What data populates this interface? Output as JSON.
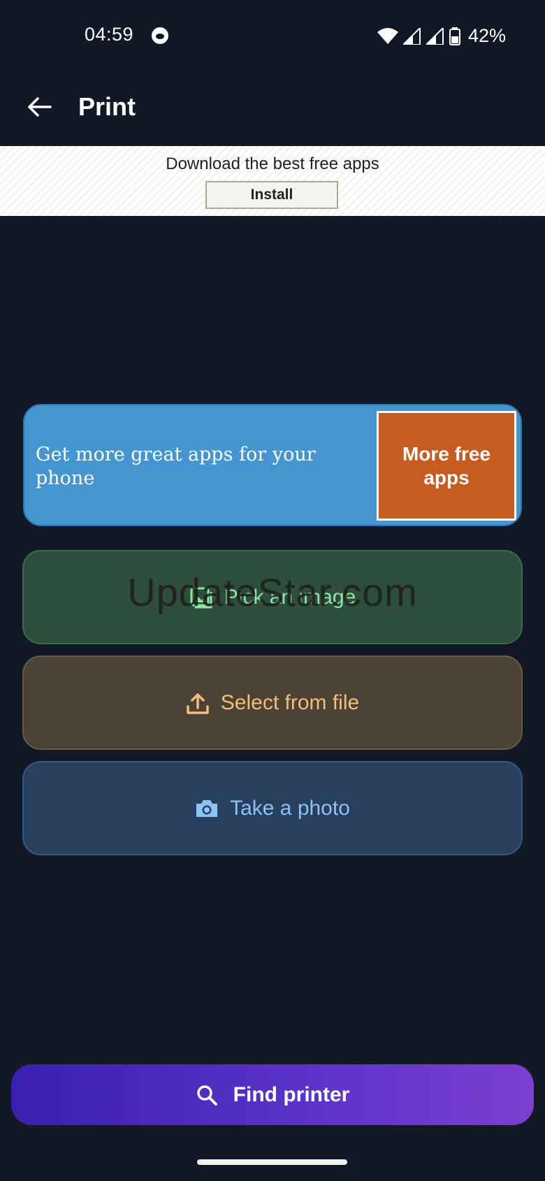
{
  "status_bar": {
    "time": "04:59",
    "battery_percent": "42%",
    "icons": [
      "notification-cat-icon",
      "wifi-icon",
      "signal-icon",
      "signal-icon",
      "battery-icon"
    ]
  },
  "app_bar": {
    "title": "Print",
    "back_icon": "arrow-left-icon"
  },
  "ad_banner": {
    "text": "Download the best free apps",
    "install_label": "Install"
  },
  "promo": {
    "text": "Get more great apps for your phone",
    "button_label": "More free apps",
    "colors": {
      "card": "#4495d0",
      "button": "#c65c21"
    }
  },
  "actions": [
    {
      "label": "Pick an image",
      "icon": "image-icon",
      "color": "#8fe6a0"
    },
    {
      "label": "Select from file",
      "icon": "upload-icon",
      "color": "#f3be7c"
    },
    {
      "label": "Take a photo",
      "icon": "camera-icon",
      "color": "#8cc2f5"
    }
  ],
  "watermark": "UpdateStar.com",
  "find_printer": {
    "label": "Find printer",
    "icon": "search-icon"
  }
}
